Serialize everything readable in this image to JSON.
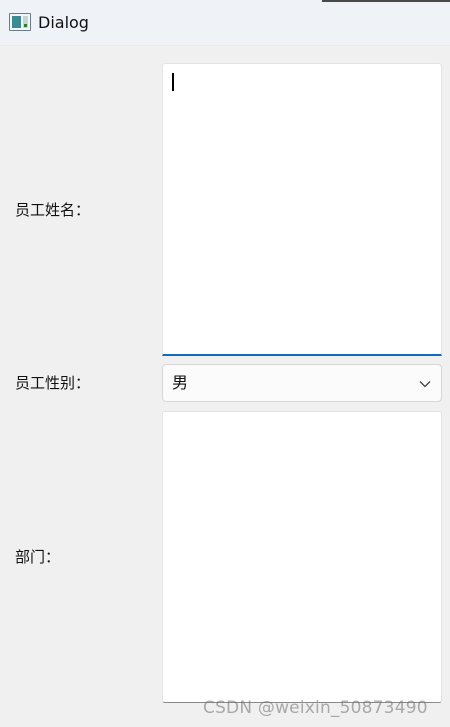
{
  "window": {
    "title": "Dialog",
    "icon": "app-window-icon"
  },
  "form": {
    "name_label": "员工姓名：",
    "name_value": "",
    "gender_label": "员工性别：",
    "gender_value": "男",
    "dept_label": "部门：",
    "dept_value": ""
  },
  "watermark": "CSDN @weixin_50873490",
  "colors": {
    "focus_accent": "#0f6cbd",
    "background": "#f0f0f0",
    "titlebar": "#eff3f8"
  }
}
